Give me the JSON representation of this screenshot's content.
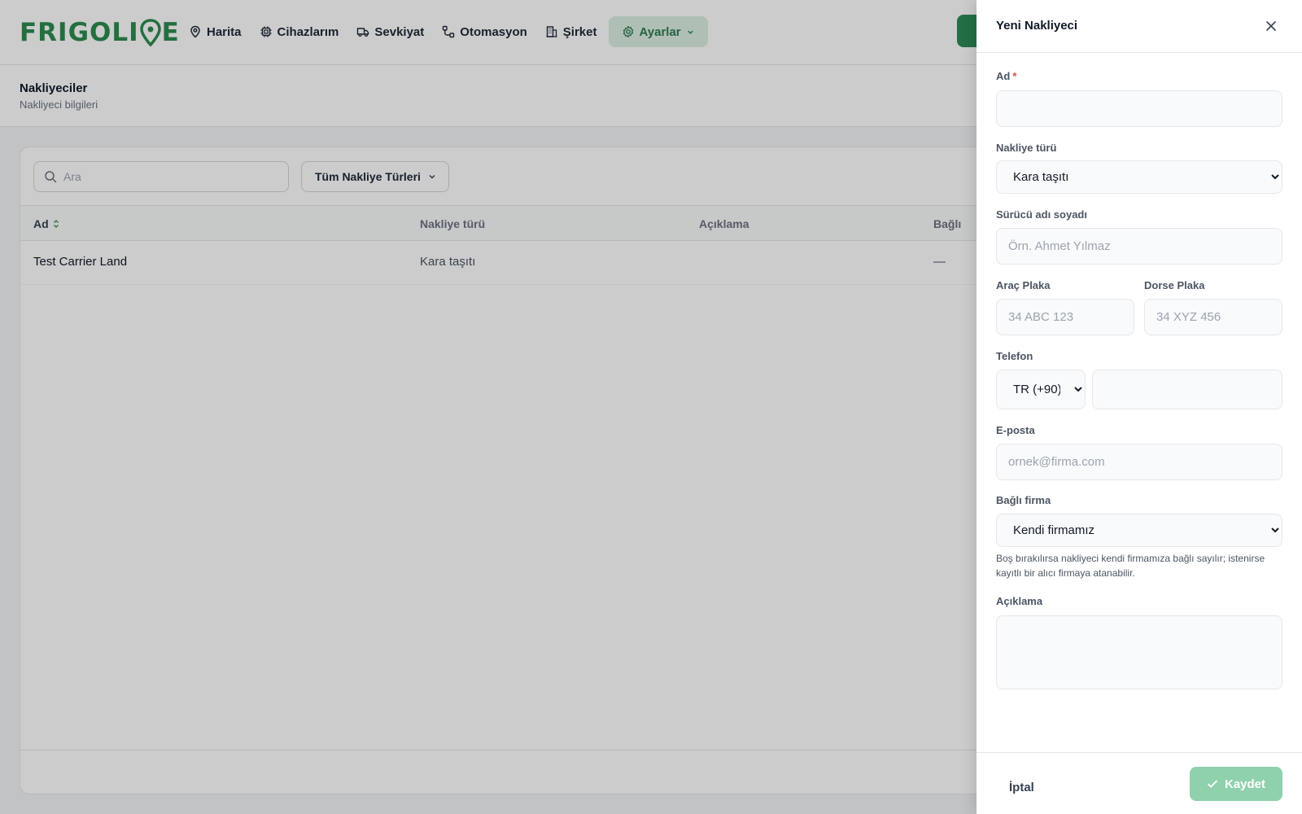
{
  "colors": {
    "brand": "#2e8b4f",
    "accent_bg": "#dcefe3",
    "save_bg": "#8fd1ad",
    "required": "#ef4444"
  },
  "header": {
    "logo": {
      "part1": "FRIGOLI",
      "part2": "E"
    },
    "nav": [
      {
        "label": "Harita",
        "icon": "map-pin-icon"
      },
      {
        "label": "Cihazlarım",
        "icon": "chip-icon"
      },
      {
        "label": "Sevkiyat",
        "icon": "truck-icon"
      },
      {
        "label": "Otomasyon",
        "icon": "workflow-icon"
      },
      {
        "label": "Şirket",
        "icon": "building-icon"
      },
      {
        "label": "Ayarlar",
        "icon": "gear-icon",
        "active": true
      }
    ]
  },
  "page": {
    "title": "Nakliyeciler",
    "subtitle": "Nakliyeci bilgileri"
  },
  "toolbar": {
    "search_placeholder": "Ara",
    "filter_label": "Tüm Nakliye Türleri"
  },
  "table": {
    "columns": [
      "Ad",
      "Nakliye türü",
      "Açıklama",
      "Bağlı"
    ],
    "rows": [
      {
        "name": "Test Carrier Land",
        "type": "Kara taşıtı",
        "description": "",
        "linked": "—"
      }
    ]
  },
  "drawer": {
    "title": "Yeni Nakliyeci",
    "name_label": "Ad",
    "required_mark": "*",
    "name_value": "",
    "transport_label": "Nakliye türü",
    "transport_value": "Kara taşıtı",
    "driver_label": "Sürücü adı soyadı",
    "driver_placeholder": "Örn. Ahmet Yılmaz",
    "vehicle_plate_label": "Araç Plaka",
    "vehicle_plate_placeholder": "34 ABC 123",
    "trailer_plate_label": "Dorse Plaka",
    "trailer_plate_placeholder": "34 XYZ 456",
    "phone_label": "Telefon",
    "phone_country": "TR (+90)",
    "phone_value": "",
    "email_label": "E-posta",
    "email_placeholder": "ornek@firma.com",
    "company_label": "Bağlı firma",
    "company_value": "Kendi firmamız",
    "company_hint": "Boş bırakılırsa nakliyeci kendi firmamıza bağlı sayılır; istenirse kayıtlı bir alıcı firmaya atanabilir.",
    "description_label": "Açıklama",
    "description_value": "",
    "cancel_label": "İptal",
    "save_label": "Kaydet"
  }
}
